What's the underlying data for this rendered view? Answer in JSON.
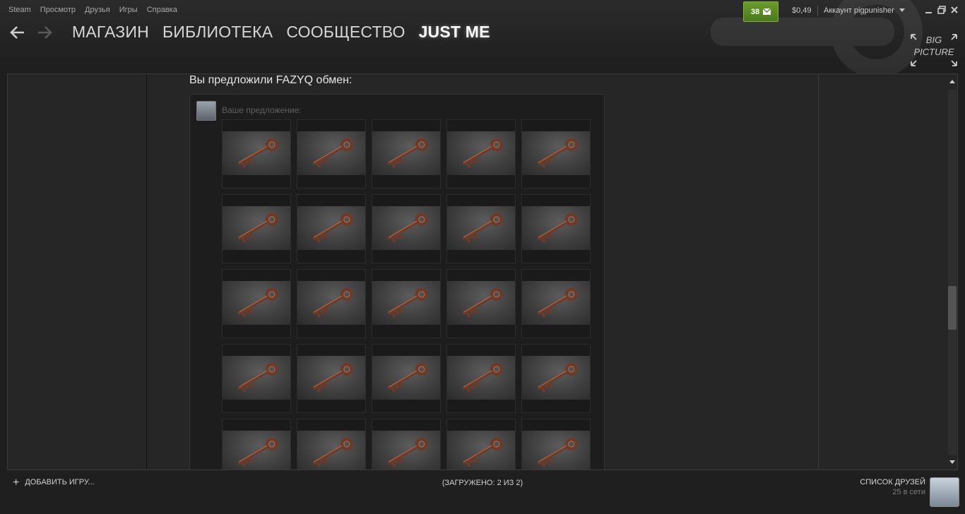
{
  "menu": [
    "Steam",
    "Просмотр",
    "Друзья",
    "Игры",
    "Справка"
  ],
  "nav": {
    "tabs": [
      "МАГАЗИН",
      "БИБЛИОТЕКА",
      "СООБЩЕСТВО",
      "JUST ME"
    ],
    "active_tab": 3
  },
  "header": {
    "message_count": "38",
    "wallet": "$0,49",
    "account": "Аккаунт pigpunisher",
    "big_picture_line1": "BIG",
    "big_picture_line2": "PICTURE"
  },
  "trade": {
    "title": "Вы предложили FAZYQ обмен:",
    "offer_label": "Ваше предложение:",
    "item_icon": "key-icon",
    "rows": 5,
    "cols": 5
  },
  "bottom": {
    "add_game": "ДОБАВИТЬ ИГРУ...",
    "loaded": "(ЗАГРУЖЕНО: 2 ИЗ 2)",
    "friends_title": "СПИСОК ДРУЗЕЙ",
    "friends_online": "25 в сети"
  },
  "colors": {
    "message_badge": "#5a8a22",
    "background": "#1f1f1f",
    "key_rust": "#6e3a26"
  }
}
